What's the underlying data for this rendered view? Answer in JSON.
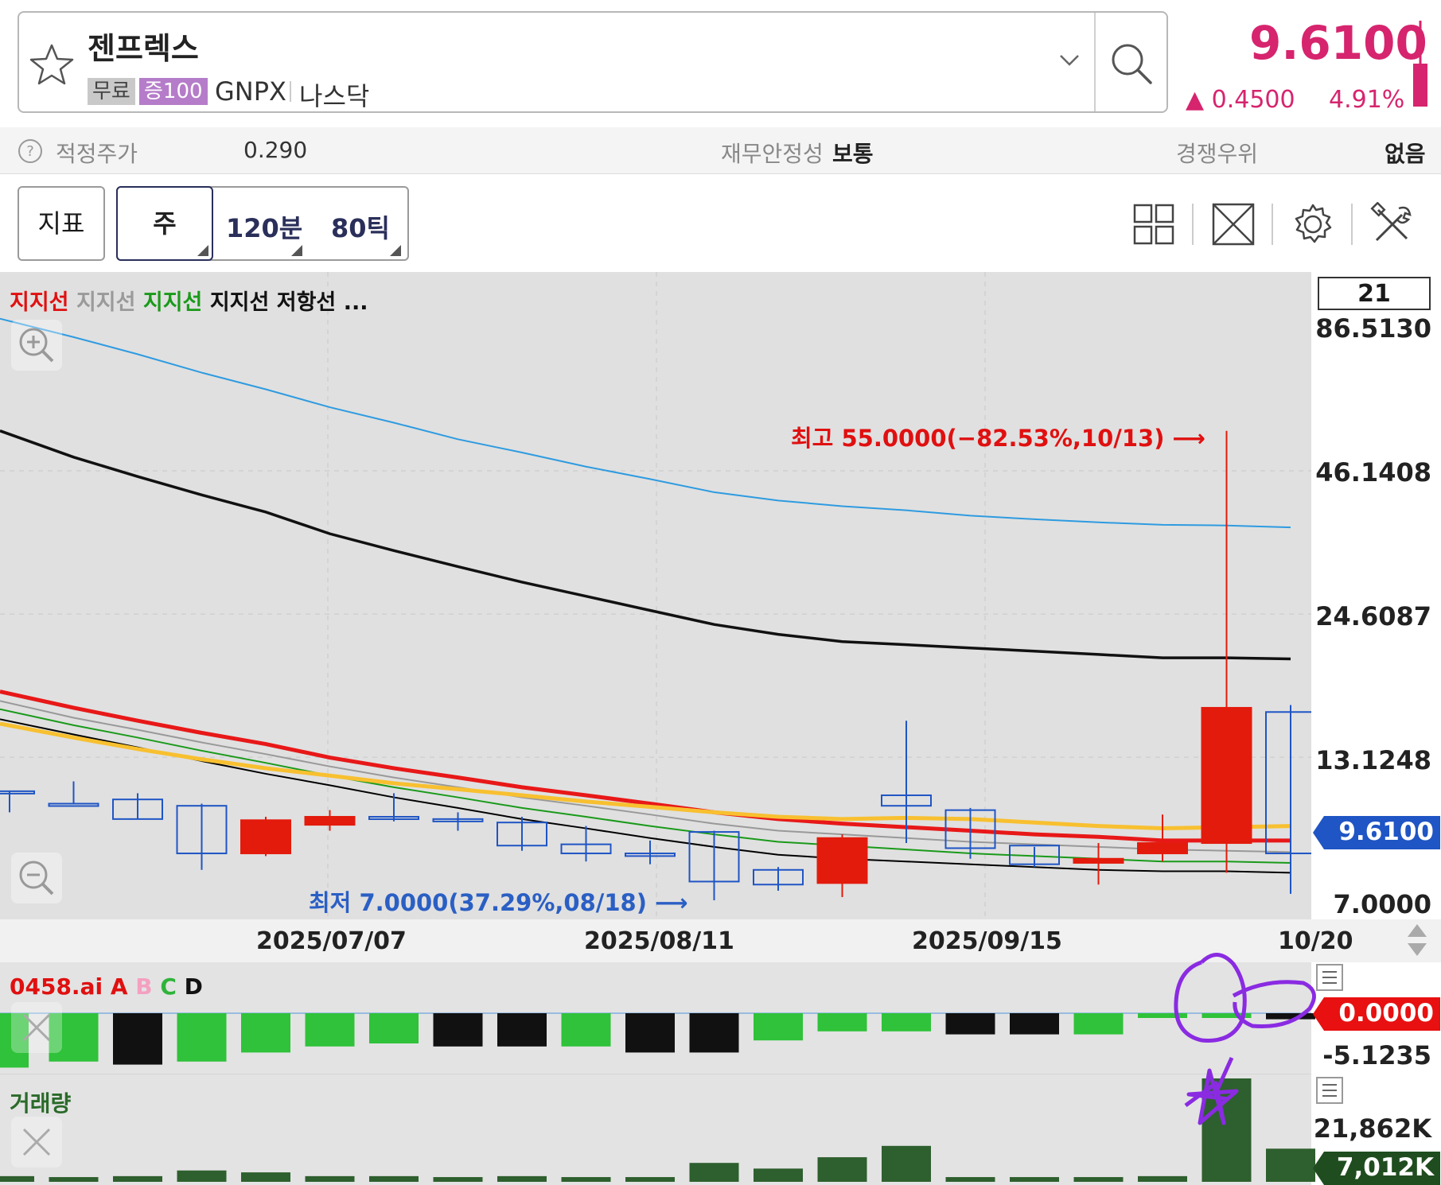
{
  "header": {
    "stock_name": "젠프렉스",
    "tag_free": "무료",
    "tag_margin": "증100",
    "ticker": "GNPX",
    "market": "나스닥",
    "price": "9.6100",
    "change": "▲ 0.4500",
    "change_pct": "4.91%",
    "accent_color": "#d6246e"
  },
  "info": {
    "fair_price_label": "적정주가",
    "fair_price_value": "0.290",
    "stability_label": "재무안정성",
    "stability_value": "보통",
    "competitive_label": "경쟁우위",
    "competitive_value": "없음"
  },
  "toolbar": {
    "indicator": "지표",
    "week": "주",
    "min120": "120분",
    "tick80": "80틱",
    "icons": [
      "grid-icon",
      "expand-icon",
      "settings-icon",
      "tools-icon"
    ]
  },
  "chart": {
    "legend": [
      {
        "text": "지지선",
        "color": "#e01010"
      },
      {
        "text": "지지선",
        "color": "#9a9a9a"
      },
      {
        "text": "지지선",
        "color": "#1a9a1a"
      },
      {
        "text": "지지선",
        "color": "#111111"
      },
      {
        "text": "저항선",
        "color": "#111111"
      },
      {
        "text": "...",
        "color": "#111111"
      }
    ],
    "period_box": "21",
    "y_ticks": [
      "86.5130",
      "46.1408",
      "24.6087",
      "13.1248",
      "7.0000"
    ],
    "current_price_tag": "9.6100",
    "high_annotation": "최고 55.0000(−82.53%,10/13) ⟶",
    "low_annotation": "최저 7.0000(37.29%,08/18) ⟶",
    "dates": [
      "2025/07/07",
      "2025/08/11",
      "2025/09/15",
      "10/20"
    ]
  },
  "indicator": {
    "name": "0458.ai",
    "a": "A",
    "b": "B",
    "c": "C",
    "d": "D",
    "value_tag": "0.0000",
    "low_label": "-5.1235"
  },
  "volume": {
    "title": "거래량",
    "max_label": "21,862K",
    "current_tag": "7,012K"
  },
  "chart_data": {
    "type": "candlestick",
    "candles": [
      {
        "o": 11.3,
        "h": 11.3,
        "l": 10.3,
        "c": 11.3,
        "dir": "up"
      },
      {
        "o": 10.7,
        "h": 11.8,
        "l": 10.7,
        "c": 10.7,
        "dir": "up"
      },
      {
        "o": 10.0,
        "h": 11.2,
        "l": 10.0,
        "c": 10.9,
        "dir": "up"
      },
      {
        "o": 8.6,
        "h": 10.7,
        "l": 8.0,
        "c": 10.6,
        "dir": "up"
      },
      {
        "o": 9.95,
        "h": 10.1,
        "l": 8.5,
        "c": 8.6,
        "dir": "down"
      },
      {
        "o": 10.1,
        "h": 10.4,
        "l": 9.5,
        "c": 9.75,
        "dir": "down"
      },
      {
        "o": 10.1,
        "h": 11.2,
        "l": 9.9,
        "c": 10.1,
        "dir": "up"
      },
      {
        "o": 10.0,
        "h": 10.3,
        "l": 9.5,
        "c": 10.0,
        "dir": "up"
      },
      {
        "o": 8.9,
        "h": 10.1,
        "l": 8.7,
        "c": 9.85,
        "dir": "up"
      },
      {
        "o": 8.6,
        "h": 9.7,
        "l": 8.3,
        "c": 8.95,
        "dir": "up"
      },
      {
        "o": 8.5,
        "h": 9.1,
        "l": 8.2,
        "c": 8.6,
        "dir": "up"
      },
      {
        "o": 7.6,
        "h": 9.5,
        "l": 7.0,
        "c": 9.45,
        "dir": "up"
      },
      {
        "o": 7.5,
        "h": 8.1,
        "l": 7.3,
        "c": 8.0,
        "dir": "up"
      },
      {
        "o": 9.2,
        "h": 9.35,
        "l": 7.1,
        "c": 7.55,
        "dir": "down"
      },
      {
        "o": 10.6,
        "h": 15.4,
        "l": 9.0,
        "c": 11.1,
        "dir": "up"
      },
      {
        "o": 8.8,
        "h": 10.5,
        "l": 8.4,
        "c": 10.4,
        "dir": "up"
      },
      {
        "o": 8.2,
        "h": 8.85,
        "l": 8.1,
        "c": 8.9,
        "dir": "up"
      },
      {
        "o": 8.4,
        "h": 9.0,
        "l": 7.5,
        "c": 8.25,
        "dir": "down"
      },
      {
        "o": 9.0,
        "h": 10.2,
        "l": 8.3,
        "c": 8.6,
        "dir": "down"
      },
      {
        "o": 16.3,
        "h": 55.0,
        "l": 7.9,
        "c": 9.0,
        "dir": "down"
      },
      {
        "o": 8.6,
        "h": 16.5,
        "l": 7.2,
        "c": 16.0,
        "dir": "up"
      }
    ],
    "ylim": [
      7.0,
      86.513
    ],
    "ylog": true,
    "ma_lines": [
      {
        "color": "#2e9be0",
        "values": [
          90,
          83,
          77,
          71,
          66,
          61,
          57,
          53,
          50,
          47,
          44.5,
          42,
          40.5,
          39.5,
          38.8,
          37.9,
          37.3,
          36.8,
          36.4,
          36.3,
          36.0
        ]
      },
      {
        "color": "#111111",
        "values": [
          55,
          49,
          45,
          41.5,
          38.5,
          35,
          32.5,
          30.3,
          28.3,
          26.6,
          25.0,
          23.5,
          22.5,
          21.8,
          21.5,
          21.2,
          20.9,
          20.6,
          20.3,
          20.3,
          20.2
        ]
      },
      {
        "color": "#e81818",
        "values": [
          17.5,
          16.3,
          15.4,
          14.6,
          13.9,
          13.1,
          12.5,
          12.0,
          11.5,
          11.1,
          10.7,
          10.3,
          10.0,
          9.8,
          9.65,
          9.5,
          9.35,
          9.25,
          9.1,
          9.1,
          9.1
        ]
      },
      {
        "color": "#999999",
        "values": [
          16.8,
          15.6,
          14.8,
          14.0,
          13.3,
          12.6,
          12.0,
          11.5,
          11.0,
          10.6,
          10.2,
          9.8,
          9.5,
          9.35,
          9.2,
          9.05,
          8.95,
          8.85,
          8.75,
          8.7,
          8.65
        ]
      },
      {
        "color": "#1a9a1a",
        "values": [
          16.2,
          15.1,
          14.3,
          13.5,
          12.8,
          12.1,
          11.5,
          11.0,
          10.5,
          10.1,
          9.7,
          9.35,
          9.05,
          8.9,
          8.75,
          8.6,
          8.5,
          8.4,
          8.3,
          8.3,
          8.25
        ]
      },
      {
        "color": "#000000",
        "values": [
          15.5,
          14.5,
          13.7,
          12.9,
          12.2,
          11.6,
          11.0,
          10.5,
          10.0,
          9.6,
          9.2,
          8.85,
          8.55,
          8.4,
          8.3,
          8.2,
          8.1,
          8.0,
          7.95,
          7.95,
          7.9
        ]
      },
      {
        "color": "#f8c030",
        "values": [
          15.2,
          14.3,
          13.6,
          13.0,
          12.5,
          12.1,
          11.7,
          11.4,
          11.1,
          10.8,
          10.55,
          10.3,
          10.1,
          10.0,
          10.05,
          10.0,
          9.85,
          9.7,
          9.6,
          9.65,
          9.7
        ]
      }
    ],
    "indicator_bars": [
      {
        "v": -1.8,
        "color": "#2fc23a"
      },
      {
        "v": -1.6,
        "color": "#2fc23a"
      },
      {
        "v": -1.7,
        "color": "#111111"
      },
      {
        "v": -1.6,
        "color": "#2fc23a"
      },
      {
        "v": -1.3,
        "color": "#2fc23a"
      },
      {
        "v": -1.1,
        "color": "#2fc23a"
      },
      {
        "v": -1.0,
        "color": "#2fc23a"
      },
      {
        "v": -1.1,
        "color": "#111111"
      },
      {
        "v": -1.1,
        "color": "#111111"
      },
      {
        "v": -1.1,
        "color": "#2fc23a"
      },
      {
        "v": -1.3,
        "color": "#111111"
      },
      {
        "v": -1.3,
        "color": "#111111"
      },
      {
        "v": -0.9,
        "color": "#2fc23a"
      },
      {
        "v": -0.6,
        "color": "#2fc23a"
      },
      {
        "v": -0.6,
        "color": "#2fc23a"
      },
      {
        "v": -0.7,
        "color": "#111111"
      },
      {
        "v": -0.7,
        "color": "#111111"
      },
      {
        "v": -0.7,
        "color": "#2fc23a"
      },
      {
        "v": 0,
        "color": "#2fc23a"
      },
      {
        "v": 0,
        "color": "#2fc23a"
      },
      {
        "v": -0.2,
        "color": "#111111"
      }
    ],
    "volume": [
      300,
      250,
      300,
      600,
      500,
      300,
      300,
      250,
      300,
      250,
      250,
      1000,
      700,
      1300,
      1900,
      250,
      250,
      250,
      300,
      21862,
      7012
    ]
  }
}
